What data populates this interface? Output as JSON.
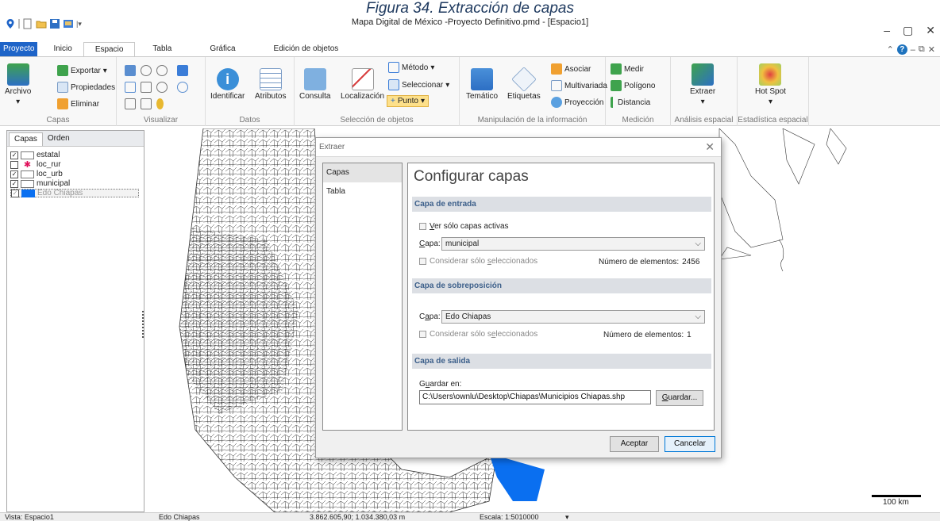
{
  "caption": "Figura 34. Extracción de capas",
  "window": {
    "title": "Mapa Digital de México -Proyecto Definitivo.pmd - [Espacio1]",
    "minimize": "–",
    "restore": "▢",
    "close": "✕",
    "help": "?"
  },
  "tabs": [
    "Proyecto",
    "Inicio",
    "Espacio",
    "Tabla",
    "Gráfica",
    "Edición de objetos"
  ],
  "ribbon": {
    "capas": {
      "label": "Capas",
      "archivo": "Archivo",
      "exportar": "Exportar",
      "propiedades": "Propiedades",
      "eliminar": "Eliminar"
    },
    "visualizar": {
      "label": "Visualizar"
    },
    "datos": {
      "label": "Datos",
      "identificar": "Identificar",
      "atributos": "Atributos"
    },
    "seleccion": {
      "label": "Selección de objetos",
      "consulta": "Consulta",
      "localizacion": "Localización",
      "metodo": "Método",
      "seleccionar": "Seleccionar",
      "punto": "Punto"
    },
    "manipulacion": {
      "label": "Manipulación de la información",
      "tematico": "Temático",
      "etiquetas": "Etiquetas",
      "asociar": "Asociar",
      "multivariada": "Multivariada",
      "proyeccion": "Proyección"
    },
    "medicion": {
      "label": "Medición",
      "medir": "Medir",
      "poligono": "Polígono",
      "distancia": "Distancia"
    },
    "analisis": {
      "label": "Análisis espacial",
      "extraer": "Extraer"
    },
    "estadistica": {
      "label": "Estadística espacial",
      "hotspot": "Hot Spot"
    }
  },
  "leftpanel": {
    "tabs": [
      "Capas",
      "Orden"
    ],
    "layers": [
      {
        "name": "estatal",
        "checked": true
      },
      {
        "name": "loc_rur",
        "checked": false
      },
      {
        "name": "loc_urb",
        "checked": true
      },
      {
        "name": "municipal",
        "checked": true
      },
      {
        "name": "Edo Chiapas",
        "checked": true
      }
    ]
  },
  "dialog": {
    "title": "Extraer",
    "close": "✕",
    "nav": [
      "Capas",
      "Tabla"
    ],
    "heading": "Configurar capas",
    "entrada": {
      "section": "Capa de entrada",
      "ver_activas_prefix": "V",
      "ver_activas_rest": "er sólo capas activas",
      "capa_label_u": "C",
      "capa_label_rest": "apa:",
      "capa_value": "municipal",
      "considerar_a": "Considerar sólo ",
      "considerar_u": "s",
      "considerar_b": "eleccionados",
      "num_label": "Número de elementos:",
      "num_value": "2456"
    },
    "sobreposicion": {
      "section": "Capa de sobreposición",
      "capa_label_a": "C",
      "capa_label_u": "a",
      "capa_label_rest": "pa:",
      "capa_value": "Edo Chiapas",
      "considerar_a": "Considerar sólo s",
      "considerar_u": "e",
      "considerar_b": "leccionados",
      "num_label": "Número de elementos:",
      "num_value": "1"
    },
    "salida": {
      "section": "Capa de salida",
      "guardar_label_a": "G",
      "guardar_label_u": "u",
      "guardar_label_b": "ardar en:",
      "path": "C:\\Users\\ownlu\\Desktop\\Chiapas\\Municipios Chiapas.shp",
      "guardar_btn_u": "G",
      "guardar_btn_rest": "uardar..."
    },
    "aceptar": "Aceptar",
    "cancelar": "Cancelar"
  },
  "status": {
    "vista": "Vista: Espacio1",
    "capa": "Edo Chiapas",
    "coords": "3.862.605,90; 1.034.380,03 m",
    "escala": "Escala: 1:5010000",
    "dropdown": "▾"
  },
  "scale_text": "100 km",
  "colors": {
    "accent": "#1e64c8",
    "chiapas": "#0a6ff0"
  }
}
